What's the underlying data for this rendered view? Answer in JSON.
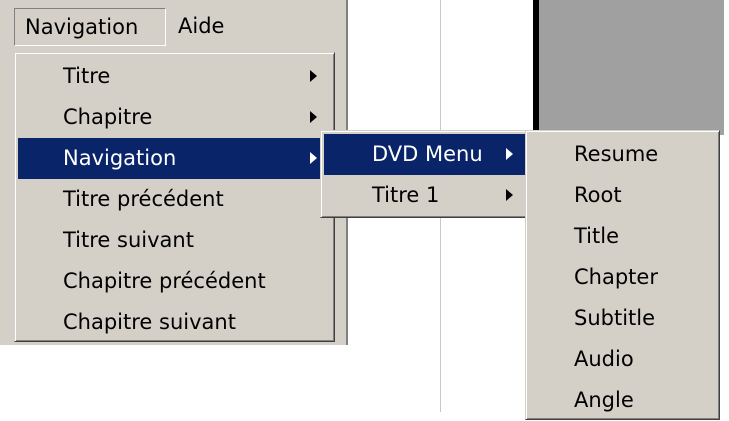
{
  "menubar": {
    "items": [
      "Navigation",
      "Aide"
    ]
  },
  "navigation_menu": {
    "items": [
      {
        "label": "Titre",
        "submenu": true
      },
      {
        "label": "Chapitre",
        "submenu": true
      },
      {
        "label": "Navigation",
        "submenu": true,
        "selected": true
      },
      {
        "label": "Titre précédent",
        "submenu": false
      },
      {
        "label": "Titre suivant",
        "submenu": false
      },
      {
        "label": "Chapitre précédent",
        "submenu": false
      },
      {
        "label": "Chapitre suivant",
        "submenu": false
      }
    ]
  },
  "navigation_submenu": {
    "items": [
      {
        "label": "DVD Menu",
        "submenu": true,
        "selected": true
      },
      {
        "label": "Titre 1",
        "submenu": true
      }
    ]
  },
  "dvd_menu_submenu": {
    "items": [
      "Resume",
      "Root",
      "Title",
      "Chapter",
      "Subtitle",
      "Audio",
      "Angle"
    ]
  },
  "colors": {
    "menu_face": "#d4d0c8",
    "highlight": "#0a246a",
    "highlight_text": "#ffffff"
  }
}
